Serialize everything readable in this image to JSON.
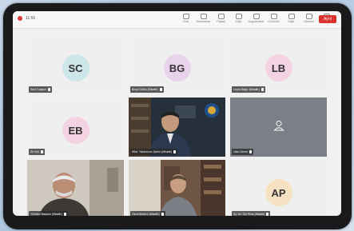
{
  "topbar": {
    "time": "11:56",
    "tools": [
      "Chat",
      "Katılımcılar",
      "Paylaş",
      "Kayıt",
      "Uygulamalar",
      "Görünüm",
      "Diğer",
      "Cihazlar",
      "Ayarlar"
    ],
    "leave_label": "Ayrıl"
  },
  "participants": [
    {
      "initials": "SC",
      "name": "Sezi Coşkun",
      "color": "#cce6ea",
      "kind": "avatar"
    },
    {
      "initials": "BG",
      "name": "Birsa Gülüş (Misafir)",
      "color": "#e9d2ec",
      "kind": "avatar"
    },
    {
      "initials": "LB",
      "name": "Leyla Bağcı (Misafir)",
      "color": "#f3d3e1",
      "kind": "avatar"
    },
    {
      "initials": "EB",
      "name": "Eb Bür",
      "color": "#f3d3e1",
      "kind": "avatar"
    },
    {
      "initials": "",
      "name": "Müd. Yardımcısı Şahin (Misafir)",
      "color": "#2d3743",
      "kind": "video"
    },
    {
      "initials": "",
      "name": "Ulan Demir",
      "color": "#7b7f87",
      "kind": "camera-off"
    },
    {
      "initials": "",
      "name": "Yönetici Başkan (Misafir)",
      "color": "#8a8278",
      "kind": "video"
    },
    {
      "initials": "",
      "name": "Okul Müdürü (Misafir)",
      "color": "#6c5848",
      "kind": "video"
    },
    {
      "initials": "AP",
      "name": "Ay. Dr. Gül Pirat (Misafir)",
      "color": "#f6e2c3",
      "kind": "avatar"
    }
  ]
}
